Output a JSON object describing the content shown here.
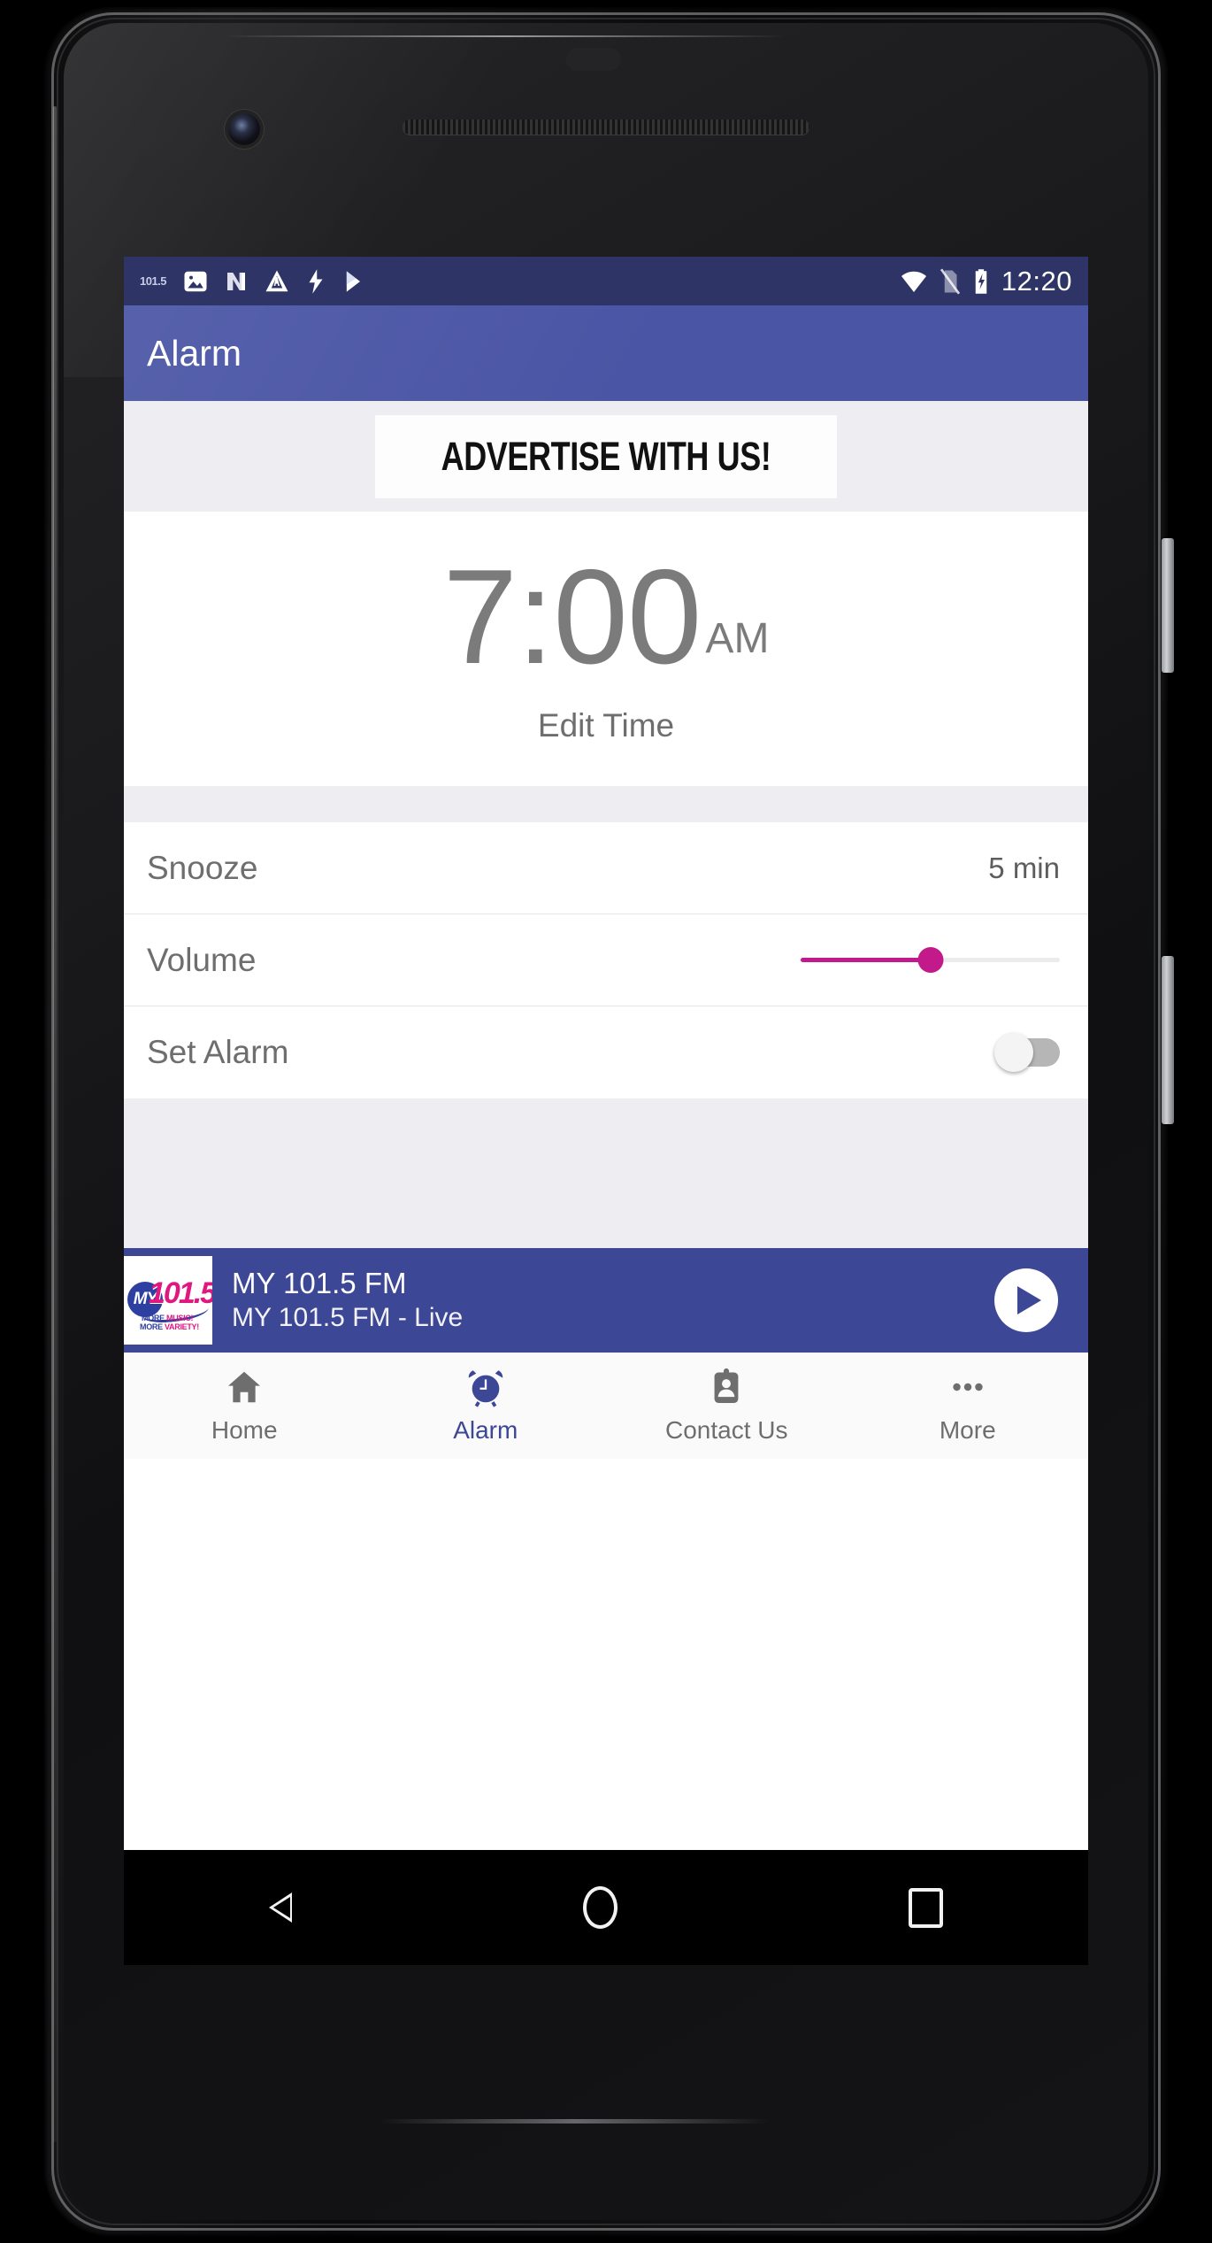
{
  "statusbar": {
    "time": "12:20",
    "left_icons": [
      "station-logo-icon",
      "photo-icon",
      "android-n-icon",
      "construction-icon",
      "flash-icon",
      "play-store-icon"
    ],
    "right_icons": [
      "wifi-icon",
      "no-sim-icon",
      "battery-charging-icon"
    ],
    "station_logo_text": "101.5",
    "background": "#2e3566"
  },
  "appbar": {
    "title": "Alarm",
    "background": "#4a55a5"
  },
  "ad": {
    "text": "ADVERTISE WITH US!"
  },
  "clock": {
    "time": "7:00",
    "meridiem": "AM",
    "edit_label": "Edit Time"
  },
  "settings": {
    "snooze": {
      "label": "Snooze",
      "value": "5 min"
    },
    "volume": {
      "label": "Volume",
      "percent": 50,
      "accent": "#c2198b"
    },
    "set_alarm": {
      "label": "Set Alarm",
      "state": "off"
    }
  },
  "player": {
    "title": "MY 101.5 FM",
    "subtitle": "MY 101.5 FM - Live",
    "play_icon": "play-icon",
    "background": "#3c4796",
    "logo": {
      "my": "MY",
      "number": "101.5",
      "tagline_1": "MORE MUSIC!",
      "tagline_2": "MORE VARIETY!"
    }
  },
  "bottomnav": {
    "items": [
      {
        "label": "Home",
        "icon": "home-icon",
        "active": false
      },
      {
        "label": "Alarm",
        "icon": "alarm-clock-icon",
        "active": true
      },
      {
        "label": "Contact Us",
        "icon": "contact-card-icon",
        "active": false
      },
      {
        "label": "More",
        "icon": "more-dots-icon",
        "active": false
      }
    ],
    "active_color": "#3c4796"
  },
  "sysnav": {
    "back": "back-button",
    "home": "home-button",
    "recents": "recents-button"
  }
}
